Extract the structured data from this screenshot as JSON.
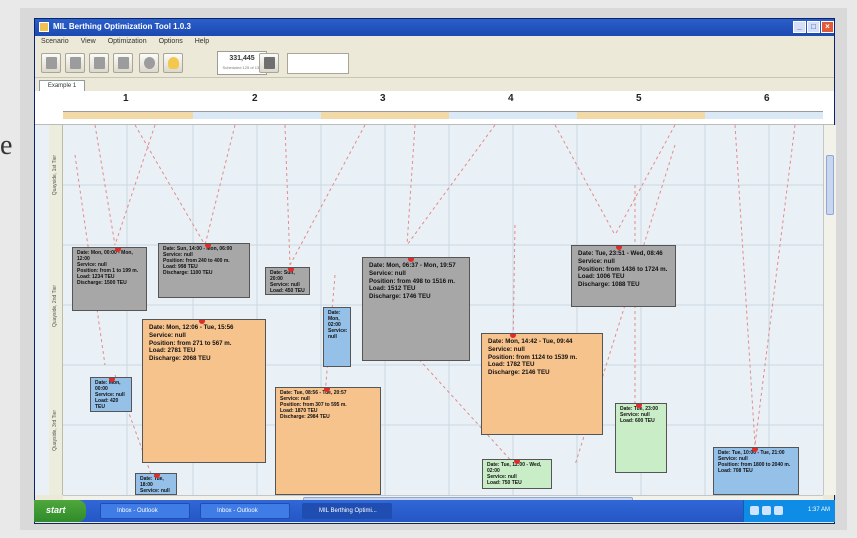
{
  "side_text": "e",
  "window": {
    "title": "MIL Berthing Optimization Tool 1.0.3",
    "controls": {
      "minimize": "_",
      "maximize": "□",
      "close": "×"
    }
  },
  "menu": [
    "Scenario",
    "View",
    "Optimization",
    "Options",
    "Help"
  ],
  "toolbar": {
    "counter_value": "331,445",
    "counter_sub": "Scheduled 125 of 134"
  },
  "tab": "Example 1",
  "days": [
    "1",
    "2",
    "3",
    "4",
    "5",
    "6"
  ],
  "quay_labels": [
    "Quayside, 1st Tier",
    "Quayside, 2nd Tier",
    "Quayside, 3rd Tier"
  ],
  "vessels": [
    {
      "color": "grey",
      "text": [
        "Date: Mon, 00:00 - Mon, 12:00",
        "Service: null",
        "Position: from 1 to 199 m.",
        "Load: 1234 TEU",
        "Discharge: 1500 TEU"
      ]
    },
    {
      "color": "grey",
      "text": [
        "Date: Sun, 14:00 - Mon, 06:00",
        "Service: null",
        "Position: from 240 to 400 m.",
        "Load: 998 TEU",
        "Discharge: 1100 TEU"
      ]
    },
    {
      "color": "grey",
      "text": [
        "Date: Sun, 20:00",
        "Service: null",
        "Load: 450 TEU"
      ]
    },
    {
      "color": "blue",
      "text": [
        "Date: Mon, 02:00",
        "Service: null"
      ]
    },
    {
      "color": "grey",
      "text": [
        "Date: Mon, 06:37 - Mon, 19:57",
        "Service: null",
        "Position: from 498 to 1516 m.",
        "Load: 1512 TEU",
        "Discharge: 1746 TEU"
      ]
    },
    {
      "color": "grey",
      "text": [
        "Date: Tue, 23:51 - Wed, 08:46",
        "Service: null",
        "Position: from 1436 to 1724 m.",
        "Load: 1006 TEU",
        "Discharge: 1088 TEU"
      ]
    },
    {
      "color": "blue",
      "text": [
        "Date: Mon, 00:00",
        "Service: null",
        "Load: 420 TEU"
      ]
    },
    {
      "color": "orange",
      "text": [
        "Date: Mon, 12:06 - Tue, 15:56",
        "Service: null",
        "Position: from 271 to 567 m.",
        "Load: 2781 TEU",
        "Discharge: 2068 TEU"
      ]
    },
    {
      "color": "orange",
      "text": [
        "Date: Tue, 08:56 - Tue, 20:57",
        "Service: null",
        "Position: from 307 to 595 m.",
        "Load: 1870 TEU",
        "Discharge: 2984 TEU"
      ]
    },
    {
      "color": "orange",
      "text": [
        "Date: Mon, 14:42 - Tue, 09:44",
        "Service: null",
        "Position: from 1124 to 1539 m.",
        "Load: 1782 TEU",
        "Discharge: 2146 TEU"
      ]
    },
    {
      "color": "green",
      "text": [
        "Date: Tue, 23:00",
        "Service: null",
        "Load: 600 TEU"
      ]
    },
    {
      "color": "green",
      "text": [
        "Date: Tue, 12:00 - Wed, 02:00",
        "Service: null",
        "Load: 750 TEU"
      ]
    },
    {
      "color": "blue",
      "text": [
        "Date: Tue, 10:00 - Tue, 21:00",
        "Service: null",
        "Position: from 1800 to 2040 m.",
        "Load: 708 TEU"
      ]
    },
    {
      "color": "blue",
      "text": [
        "Date: Tue, 18:00",
        "Service: null"
      ]
    }
  ],
  "taskbar": {
    "start": "start",
    "tasks": [
      "Inbox - Outlook",
      "Inbox - Outlook",
      "MIL Berthing Optimi..."
    ],
    "clock": "1:37 AM"
  }
}
